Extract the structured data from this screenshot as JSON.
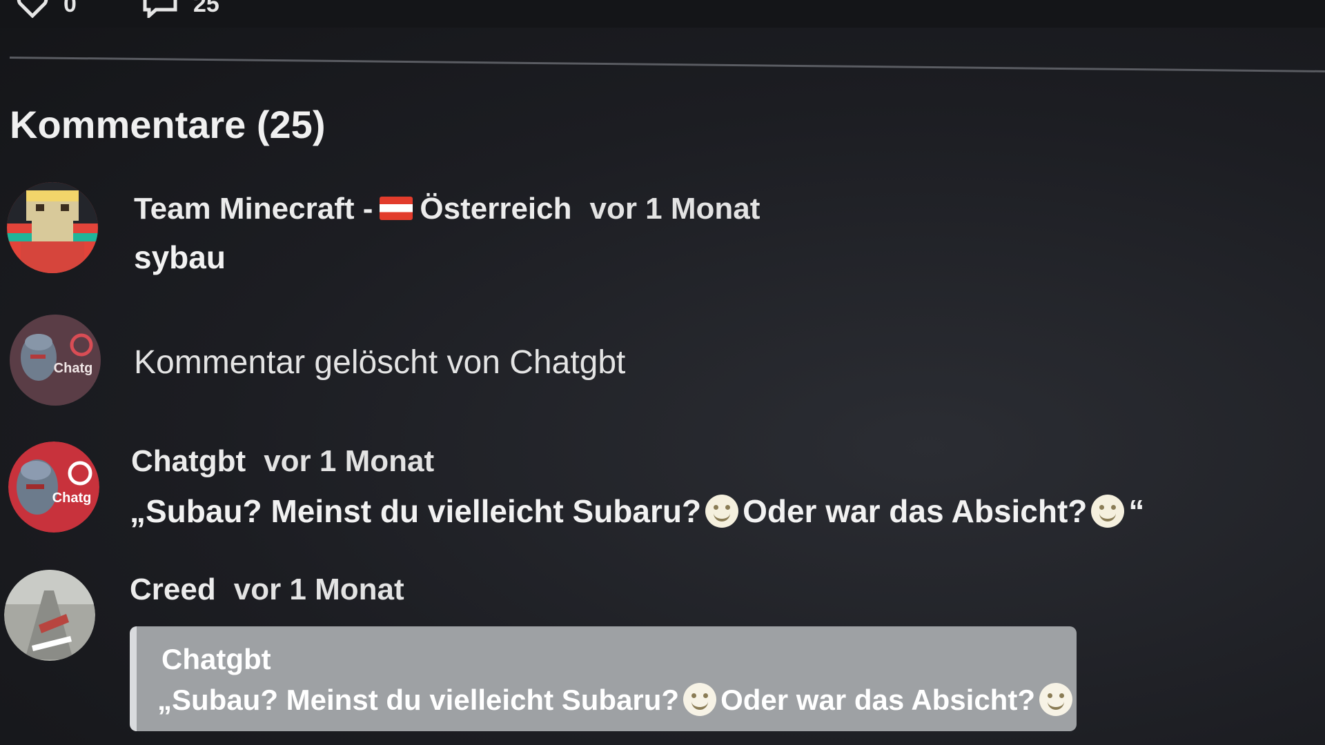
{
  "header": {
    "likes_count": "0",
    "comments_count": "25"
  },
  "comments_section": {
    "title": "Kommentare (25)"
  },
  "comments": [
    {
      "author": "Team Minecraft -",
      "author_suffix": "Österreich",
      "time": "vor 1 Monat",
      "text": "sybau"
    },
    {
      "deleted_text": "Kommentar gelöscht von Chatgbt"
    },
    {
      "author": "Chatgbt",
      "time": "vor 1 Monat",
      "text_part1": "„Subau? Meinst du vielleicht Subaru?",
      "text_part2": "Oder war das Absicht?",
      "text_end": "“"
    },
    {
      "author": "Creed",
      "time": "vor 1 Monat",
      "quote_author": "Chatgbt",
      "quote_part1": "„Subau? Meinst du vielleicht Subaru?",
      "quote_part2": "Oder war das Absicht?",
      "quote_end": "“"
    }
  ],
  "avatar_labels": {
    "chatgbt": "Chatg"
  },
  "colors": {
    "background": "#1c1d22",
    "text": "#ececec",
    "quote_background": "#9ea1a4",
    "flag_red": "#e23c2c"
  },
  "icons": {
    "like": "heart-icon",
    "comments": "comment-bubble-icon",
    "flag": "austria-flag-icon",
    "emoji": "smiley-emoji-icon"
  }
}
